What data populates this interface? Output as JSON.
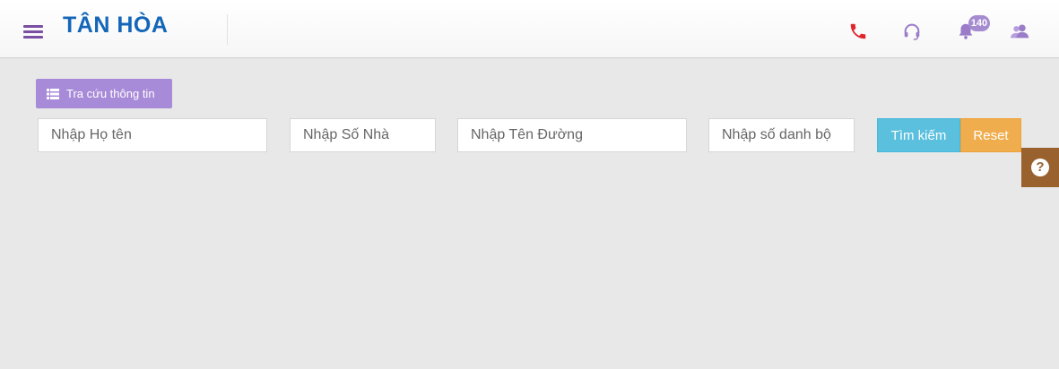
{
  "header": {
    "logo_text": "TÂN HÒA",
    "notification_count": "140",
    "icons": [
      "hamburger-menu-icon",
      "phone-icon",
      "headset-icon",
      "bell-icon",
      "users-icon"
    ]
  },
  "toolbar": {
    "lookup_button_label": "Tra cứu thông tin"
  },
  "search": {
    "name_placeholder": "Nhập Họ tên",
    "house_number_placeholder": "Nhập Số Nhà",
    "street_placeholder": "Nhập Tên Đường",
    "account_placeholder": "Nhập số danh bộ",
    "search_button_label": "Tìm kiếm",
    "reset_button_label": "Reset"
  },
  "help": {
    "icon_text": "?"
  },
  "colors": {
    "brand_blue": "#1466b8",
    "accent_purple": "#a88bd8",
    "search_blue": "#5bc0de",
    "reset_orange": "#f0ad4e",
    "help_brown": "#99612e",
    "phone_red": "#e0262b"
  }
}
